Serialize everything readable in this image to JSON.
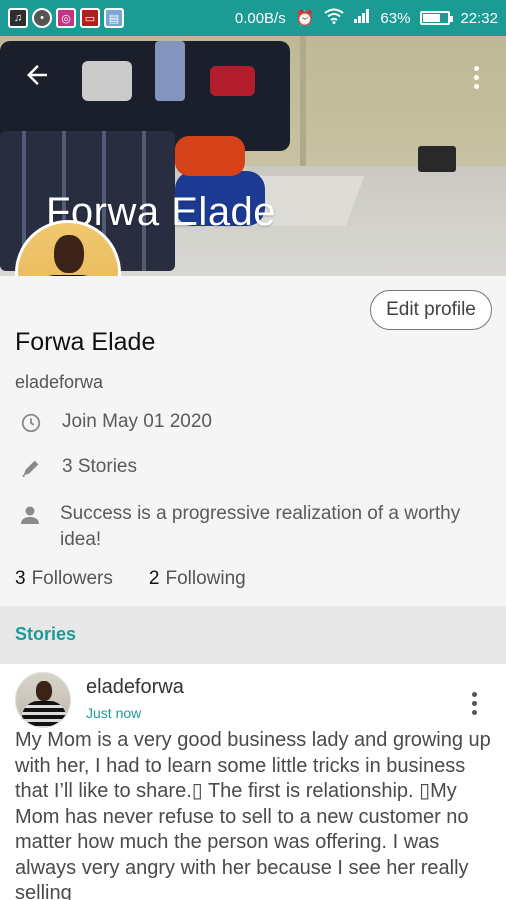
{
  "status_bar": {
    "net_speed": "0.00B/s",
    "battery": "63%",
    "time": "22:32",
    "icons": [
      "music-icon",
      "circle-app-icon",
      "instagram-icon",
      "tv-icon",
      "gallery-icon",
      "alarm-icon",
      "wifi-icon",
      "signal-icon",
      "battery-icon"
    ]
  },
  "header": {
    "cover_title": "Forwa Elade",
    "back_icon": "arrow-left-icon",
    "menu_icon": "more-vert-icon"
  },
  "profile": {
    "edit_label": "Edit profile",
    "display_name": "Forwa Elade",
    "username": "eladeforwa",
    "joined": "Join May 01 2020",
    "stories": "3 Stories",
    "bio": "Success is a progressive realization of a worthy idea!",
    "followers_count": "3",
    "followers_label": "Followers",
    "following_count": "2",
    "following_label": "Following"
  },
  "stories_section": {
    "title": "Stories"
  },
  "post": {
    "username": "eladeforwa",
    "time": "Just now",
    "text": "My Mom is a very good business lady and growing up with her, I had to learn some little tricks in business that I’ll like to share.▯ The first is relationship. ▯My Mom has never refuse to sell to a new customer no matter how much the person was offering. I was always very angry with her because I see her really selling"
  },
  "colors": {
    "accent": "#1b9b94",
    "status_bar": "#1b9b94"
  }
}
